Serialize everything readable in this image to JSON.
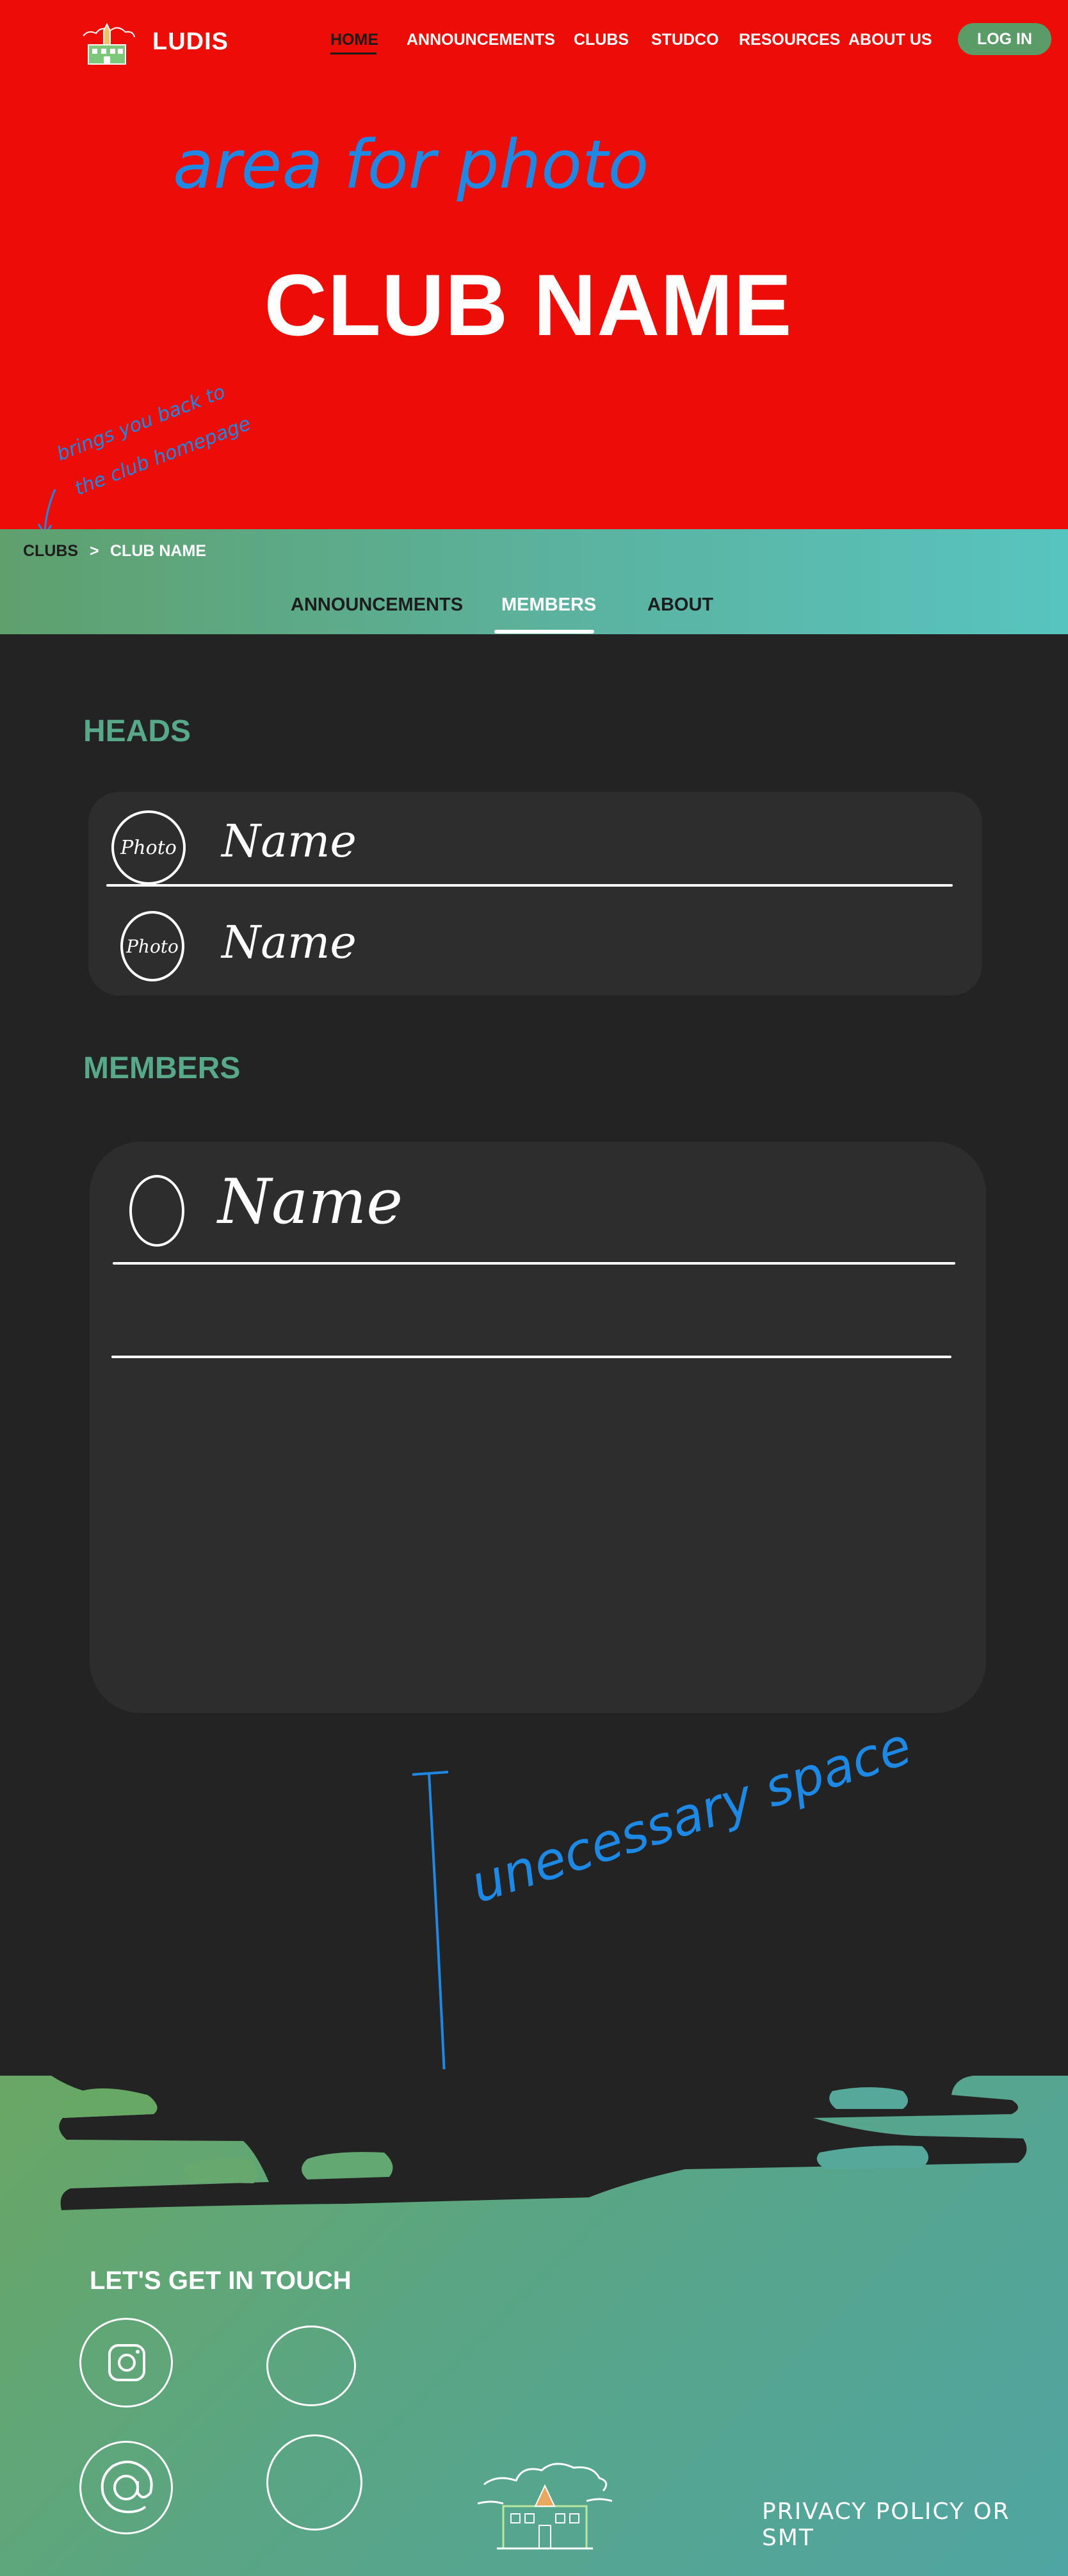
{
  "header": {
    "brand": "LUDIS",
    "nav": [
      "HOME",
      "ANNOUNCEMENTS",
      "CLUBS",
      "STUDCO",
      "RESOURCES",
      "ABOUT US"
    ],
    "login_label": "LOG IN"
  },
  "hero": {
    "title": "CLUB NAME",
    "photo_note": "area for photo",
    "back_note_line1": "brings you back to",
    "back_note_line2": "the club homepage"
  },
  "breadcrumb": {
    "root": "CLUBS",
    "separator": ">",
    "current": "CLUB NAME"
  },
  "tabs": [
    "ANNOUNCEMENTS",
    "MEMBERS",
    "ABOUT"
  ],
  "heads": {
    "title": "HEADS",
    "rows": [
      {
        "photo": "Photo",
        "name": "Name"
      },
      {
        "photo": "Photo",
        "name": "Name"
      }
    ]
  },
  "members": {
    "title": "MEMBERS",
    "rows": [
      {
        "name": "Name"
      }
    ]
  },
  "annotations": {
    "space_note": "unecessary space"
  },
  "footer": {
    "title": "LET'S GET IN TOUCH",
    "social_icons": [
      "instagram-icon",
      "blank-circle-icon",
      "at-sign-icon",
      "blank-circle-icon"
    ],
    "privacy": "PRIVACY POLICY OR SMT"
  },
  "colors": {
    "hero_red": "#ec0d06",
    "accent_green": "#58a88a",
    "login_green": "#5b9b68",
    "dark_bg": "#232323",
    "card_bg": "#2d2d2d",
    "annotation_blue": "#1e88e5"
  }
}
